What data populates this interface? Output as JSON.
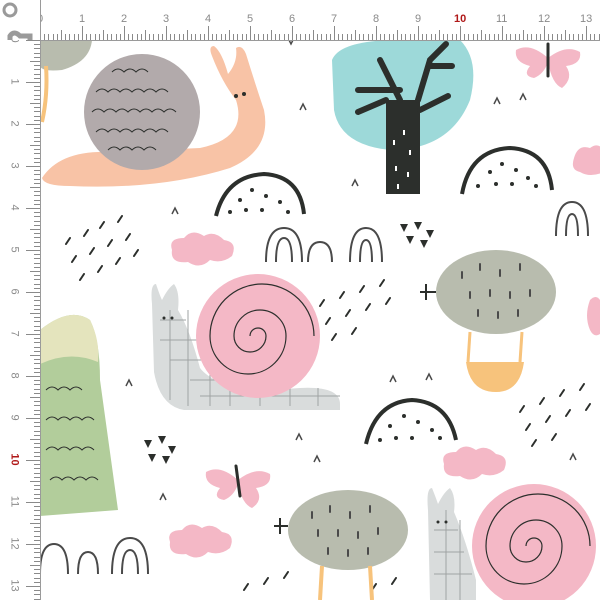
{
  "ruler": {
    "unit_labels": [
      "0",
      "1",
      "2",
      "3",
      "4",
      "5",
      "6",
      "7",
      "8",
      "9",
      "10",
      "11",
      "12",
      "13"
    ],
    "highlight_label": "10",
    "tick_color": "#8a8a8a",
    "highlight_color": "#b01818"
  },
  "pattern": {
    "background_color": "#ffffff",
    "colors": {
      "peach": "#f8c3a6",
      "pink": "#f4b8c6",
      "grey_shell": "#b2aaab",
      "sage": "#b8bcae",
      "pale_grey": "#d9dcdc",
      "teal": "#9dd9d9",
      "dark": "#2c2f2c",
      "green": "#b2cd9b",
      "cream": "#e4e4bd",
      "orange": "#f7c37c"
    },
    "motifs": [
      "snail-icon",
      "tree-icon",
      "hot-air-balloon-icon",
      "butterfly-icon",
      "cloud-icon",
      "mountain-icon",
      "hill-icon",
      "rainbow-arch-icon",
      "grass-tuft-icon"
    ]
  }
}
